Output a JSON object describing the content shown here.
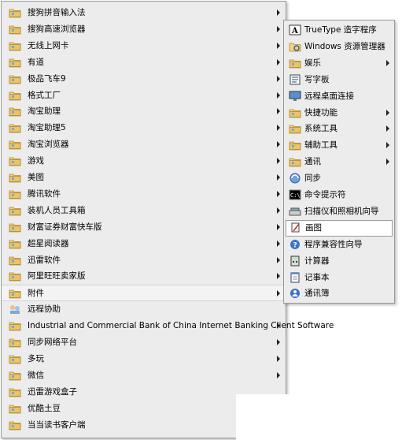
{
  "start_menu": {
    "items": [
      {
        "label": "搜狗拼音输入法",
        "icon": "folder-icon",
        "submenu": true
      },
      {
        "label": "搜狗高速浏览器",
        "icon": "folder-icon",
        "submenu": true
      },
      {
        "label": "无线上网卡",
        "icon": "folder-icon",
        "submenu": true
      },
      {
        "label": "有道",
        "icon": "folder-icon",
        "submenu": true
      },
      {
        "label": "极品飞车9",
        "icon": "folder-icon",
        "submenu": true
      },
      {
        "label": "格式工厂",
        "icon": "folder-icon",
        "submenu": true
      },
      {
        "label": "淘宝助理",
        "icon": "folder-icon",
        "submenu": true
      },
      {
        "label": "淘宝助理5",
        "icon": "folder-icon",
        "submenu": true
      },
      {
        "label": "淘宝浏览器",
        "icon": "folder-icon",
        "submenu": true
      },
      {
        "label": "游戏",
        "icon": "folder-icon",
        "submenu": true
      },
      {
        "label": "美图",
        "icon": "folder-icon",
        "submenu": true
      },
      {
        "label": "腾讯软件",
        "icon": "folder-icon",
        "submenu": true
      },
      {
        "label": "装机人员工具箱",
        "icon": "folder-icon",
        "submenu": true
      },
      {
        "label": "财富证券财富快车版",
        "icon": "folder-icon",
        "submenu": true
      },
      {
        "label": "超星阅读器",
        "icon": "folder-icon",
        "submenu": true
      },
      {
        "label": "迅雷软件",
        "icon": "folder-icon",
        "submenu": true
      },
      {
        "label": "阿里旺旺卖家版",
        "icon": "folder-icon",
        "submenu": true
      },
      {
        "label": "附件",
        "icon": "folder-icon",
        "submenu": true,
        "active": true
      },
      {
        "label": "远程协助",
        "icon": "remote-assist-icon",
        "submenu": false
      },
      {
        "label": "Industrial and Commercial Bank of China Internet Banking Client Software",
        "icon": "folder-icon",
        "submenu": true
      },
      {
        "label": "同步网络平台",
        "icon": "folder-icon",
        "submenu": true
      },
      {
        "label": "多玩",
        "icon": "folder-icon",
        "submenu": true
      },
      {
        "label": "微信",
        "icon": "folder-icon",
        "submenu": true
      },
      {
        "label": "迅雷游戏盒子",
        "icon": "folder-icon",
        "submenu": false
      },
      {
        "label": "优酷土豆",
        "icon": "folder-icon",
        "submenu": false
      },
      {
        "label": "当当读书客户端",
        "icon": "folder-icon",
        "submenu": false
      }
    ]
  },
  "accessories_menu": {
    "items": [
      {
        "label": "TrueType 造字程序",
        "icon": "font-editor-icon",
        "submenu": false
      },
      {
        "label": "Windows 资源管理器",
        "icon": "explorer-icon",
        "submenu": false
      },
      {
        "label": "娱乐",
        "icon": "folder-icon",
        "submenu": true
      },
      {
        "label": "写字板",
        "icon": "wordpad-icon",
        "submenu": false
      },
      {
        "label": "远程桌面连接",
        "icon": "remote-desktop-icon",
        "submenu": false
      },
      {
        "label": "快捷功能",
        "icon": "folder-icon",
        "submenu": true
      },
      {
        "label": "系统工具",
        "icon": "folder-icon",
        "submenu": true
      },
      {
        "label": "辅助工具",
        "icon": "folder-icon",
        "submenu": true
      },
      {
        "label": "通讯",
        "icon": "folder-icon",
        "submenu": true
      },
      {
        "label": "同步",
        "icon": "sync-icon",
        "submenu": false
      },
      {
        "label": "命令提示符",
        "icon": "cmd-icon",
        "submenu": false
      },
      {
        "label": "扫描仪和照相机向导",
        "icon": "scanner-icon",
        "submenu": false
      },
      {
        "label": "画图",
        "icon": "paint-icon",
        "submenu": false,
        "hover": true
      },
      {
        "label": "程序兼容性向导",
        "icon": "help-icon",
        "submenu": false
      },
      {
        "label": "计算器",
        "icon": "calculator-icon",
        "submenu": false
      },
      {
        "label": "记事本",
        "icon": "notepad-icon",
        "submenu": false
      },
      {
        "label": "通讯簿",
        "icon": "address-book-icon",
        "submenu": false
      }
    ]
  },
  "colors": {
    "menu_bg": "#ececec",
    "menu_border": "#9a9a9a",
    "folder": "#e9c46a",
    "hover_bg": "#ffffff"
  }
}
